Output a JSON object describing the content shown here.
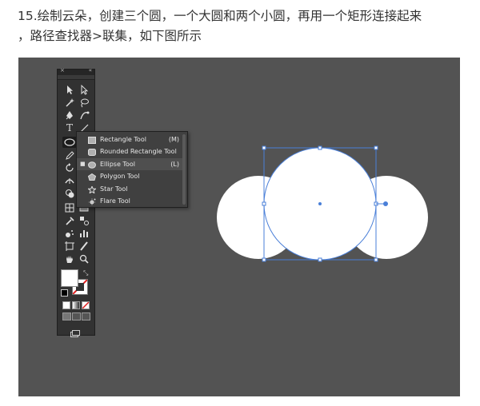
{
  "caption": {
    "line1": "15.绘制云朵，创建三个圆，一个大圆和两个小圆，再用一个矩形连接起来",
    "line2": "，路径查找器>联集，如下图所示"
  },
  "toolbar": {
    "close_glyph": "×",
    "collapse_glyph": "«",
    "tools": [
      "selection-tool",
      "direct-selection-tool",
      "magic-wand-tool",
      "lasso-tool",
      "pen-tool",
      "curvature-tool",
      "type-tool",
      "line-segment-tool",
      "ellipse-tool",
      "paintbrush-tool",
      "pencil-tool",
      "eraser-tool",
      "rotate-tool",
      "scale-tool",
      "width-tool",
      "free-transform-tool",
      "shape-builder-tool",
      "perspective-grid-tool",
      "mesh-tool",
      "gradient-tool",
      "eyedropper-tool",
      "blend-tool",
      "symbol-sprayer-tool",
      "column-graph-tool",
      "artboard-tool",
      "slice-tool",
      "hand-tool",
      "zoom-tool"
    ],
    "type_glyph": "T"
  },
  "flyout": {
    "items": [
      {
        "label": "Rectangle Tool",
        "key": "(M)",
        "icon": "rectangle-icon"
      },
      {
        "label": "Rounded Rectangle Tool",
        "key": "",
        "icon": "rounded-rectangle-icon"
      },
      {
        "label": "Ellipse Tool",
        "key": "(L)",
        "icon": "ellipse-icon",
        "selected": true
      },
      {
        "label": "Polygon Tool",
        "key": "",
        "icon": "polygon-icon"
      },
      {
        "label": "Star Tool",
        "key": "",
        "icon": "star-icon"
      },
      {
        "label": "Flare Tool",
        "key": "",
        "icon": "flare-icon"
      }
    ],
    "selected_bullet": "■"
  },
  "colors": {
    "canvas": "#535353",
    "selection": "#4a7fd8",
    "shape_fill": "#ffffff",
    "toolbar": "#323232"
  }
}
